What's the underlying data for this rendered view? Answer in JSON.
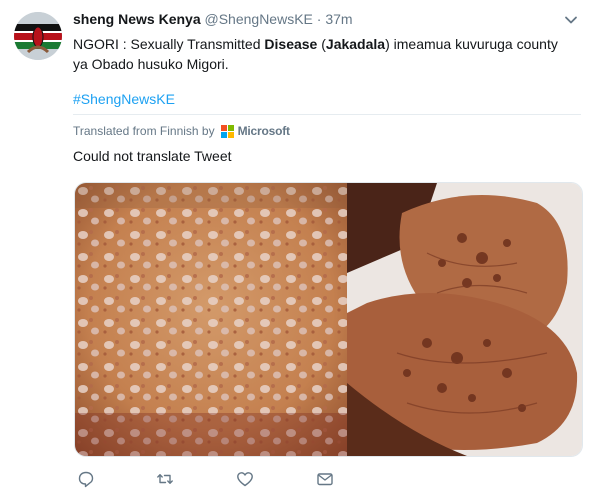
{
  "tweet": {
    "display_name": "sheng News Kenya",
    "handle": "@ShengNewsKE",
    "separator": "·",
    "time": "37m",
    "text_parts": {
      "p1": "NGORI :  Sexually Transmitted ",
      "p2": "Disease",
      "p3": " (",
      "p4": "Jakadala",
      "p5": ") imeamua kuvuruga county ya Obado husuko Migori."
    },
    "hashtag": "#ShengNewsKE",
    "translated_from": "Translated from Finnish by",
    "translator": "Microsoft",
    "translate_message": "Could not translate Tweet"
  },
  "icons": {
    "avatar": "kenya-flag-avatar",
    "menu": "chevron-down-icon",
    "reply": "reply-icon",
    "retweet": "retweet-icon",
    "like": "heart-icon",
    "dm": "envelope-icon"
  },
  "colors": {
    "link": "#1da1f2",
    "secondary_text": "#657786",
    "icon": "#657786"
  }
}
